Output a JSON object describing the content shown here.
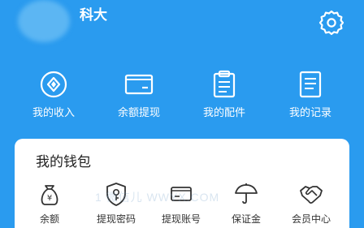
{
  "header": {
    "username": "科大"
  },
  "actions": [
    {
      "label": "我的收入",
      "icon": "diamond-circle-icon"
    },
    {
      "label": "余额提现",
      "icon": "card-icon"
    },
    {
      "label": "我的配件",
      "icon": "clipboard-icon"
    },
    {
      "label": "我的记录",
      "icon": "document-list-icon"
    }
  ],
  "wallet": {
    "title": "我的钱包",
    "items": [
      {
        "label": "余额",
        "icon": "money-bag-icon"
      },
      {
        "label": "提现密码",
        "icon": "shield-key-icon"
      },
      {
        "label": "提现账号",
        "icon": "bank-card-icon"
      },
      {
        "label": "保证金",
        "icon": "umbrella-icon"
      },
      {
        "label": "会员中心",
        "icon": "handshake-icon"
      }
    ]
  },
  "watermark": "1 微信儿 WWYX.COM",
  "colors": {
    "header_bg": "#2a9bef",
    "card_bg": "#ffffff",
    "icon_dark": "#333333"
  }
}
